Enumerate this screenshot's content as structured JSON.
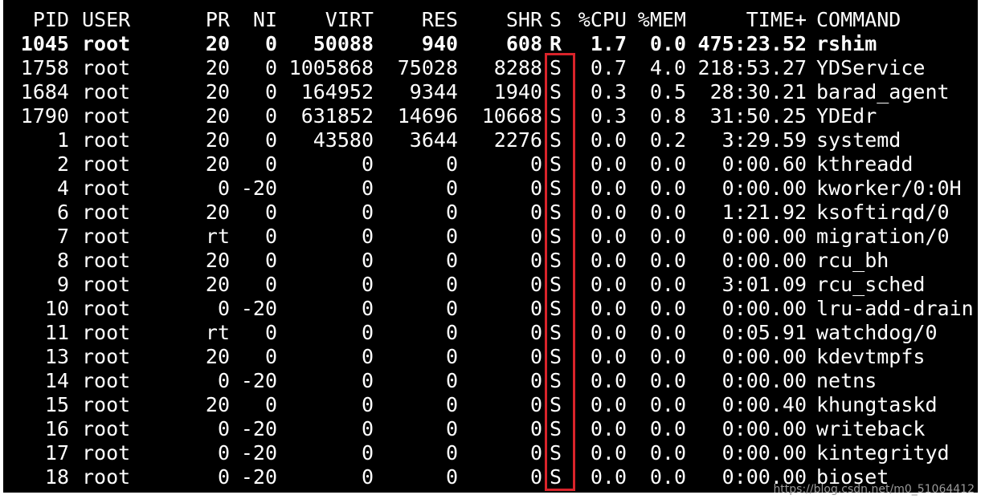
{
  "header": {
    "pid": "PID",
    "user": "USER",
    "pr": "PR",
    "ni": "NI",
    "virt": "VIRT",
    "res": "RES",
    "shr": "SHR",
    "s": "S",
    "cpu": "%CPU",
    "mem": "%MEM",
    "time": "TIME+",
    "command": "COMMAND"
  },
  "rows": [
    {
      "pid": "1045",
      "user": "root",
      "pr": "20",
      "ni": "0",
      "virt": "50088",
      "res": "940",
      "shr": "608",
      "s": "R",
      "cpu": "1.7",
      "mem": "0.0",
      "time": "475:23.52",
      "command": "rshim",
      "bold": true
    },
    {
      "pid": "1758",
      "user": "root",
      "pr": "20",
      "ni": "0",
      "virt": "1005868",
      "res": "75028",
      "shr": "8288",
      "s": "S",
      "cpu": "0.7",
      "mem": "4.0",
      "time": "218:53.27",
      "command": "YDService"
    },
    {
      "pid": "1684",
      "user": "root",
      "pr": "20",
      "ni": "0",
      "virt": "164952",
      "res": "9344",
      "shr": "1940",
      "s": "S",
      "cpu": "0.3",
      "mem": "0.5",
      "time": "28:30.21",
      "command": "barad_agent"
    },
    {
      "pid": "1790",
      "user": "root",
      "pr": "20",
      "ni": "0",
      "virt": "631852",
      "res": "14696",
      "shr": "10668",
      "s": "S",
      "cpu": "0.3",
      "mem": "0.8",
      "time": "31:50.25",
      "command": "YDEdr"
    },
    {
      "pid": "1",
      "user": "root",
      "pr": "20",
      "ni": "0",
      "virt": "43580",
      "res": "3644",
      "shr": "2276",
      "s": "S",
      "cpu": "0.0",
      "mem": "0.2",
      "time": "3:29.59",
      "command": "systemd"
    },
    {
      "pid": "2",
      "user": "root",
      "pr": "20",
      "ni": "0",
      "virt": "0",
      "res": "0",
      "shr": "0",
      "s": "S",
      "cpu": "0.0",
      "mem": "0.0",
      "time": "0:00.60",
      "command": "kthreadd"
    },
    {
      "pid": "4",
      "user": "root",
      "pr": "0",
      "ni": "-20",
      "virt": "0",
      "res": "0",
      "shr": "0",
      "s": "S",
      "cpu": "0.0",
      "mem": "0.0",
      "time": "0:00.00",
      "command": "kworker/0:0H"
    },
    {
      "pid": "6",
      "user": "root",
      "pr": "20",
      "ni": "0",
      "virt": "0",
      "res": "0",
      "shr": "0",
      "s": "S",
      "cpu": "0.0",
      "mem": "0.0",
      "time": "1:21.92",
      "command": "ksoftirqd/0"
    },
    {
      "pid": "7",
      "user": "root",
      "pr": "rt",
      "ni": "0",
      "virt": "0",
      "res": "0",
      "shr": "0",
      "s": "S",
      "cpu": "0.0",
      "mem": "0.0",
      "time": "0:00.00",
      "command": "migration/0"
    },
    {
      "pid": "8",
      "user": "root",
      "pr": "20",
      "ni": "0",
      "virt": "0",
      "res": "0",
      "shr": "0",
      "s": "S",
      "cpu": "0.0",
      "mem": "0.0",
      "time": "0:00.00",
      "command": "rcu_bh"
    },
    {
      "pid": "9",
      "user": "root",
      "pr": "20",
      "ni": "0",
      "virt": "0",
      "res": "0",
      "shr": "0",
      "s": "S",
      "cpu": "0.0",
      "mem": "0.0",
      "time": "3:01.09",
      "command": "rcu_sched"
    },
    {
      "pid": "10",
      "user": "root",
      "pr": "0",
      "ni": "-20",
      "virt": "0",
      "res": "0",
      "shr": "0",
      "s": "S",
      "cpu": "0.0",
      "mem": "0.0",
      "time": "0:00.00",
      "command": "lru-add-drain"
    },
    {
      "pid": "11",
      "user": "root",
      "pr": "rt",
      "ni": "0",
      "virt": "0",
      "res": "0",
      "shr": "0",
      "s": "S",
      "cpu": "0.0",
      "mem": "0.0",
      "time": "0:05.91",
      "command": "watchdog/0"
    },
    {
      "pid": "13",
      "user": "root",
      "pr": "20",
      "ni": "0",
      "virt": "0",
      "res": "0",
      "shr": "0",
      "s": "S",
      "cpu": "0.0",
      "mem": "0.0",
      "time": "0:00.00",
      "command": "kdevtmpfs"
    },
    {
      "pid": "14",
      "user": "root",
      "pr": "0",
      "ni": "-20",
      "virt": "0",
      "res": "0",
      "shr": "0",
      "s": "S",
      "cpu": "0.0",
      "mem": "0.0",
      "time": "0:00.00",
      "command": "netns"
    },
    {
      "pid": "15",
      "user": "root",
      "pr": "20",
      "ni": "0",
      "virt": "0",
      "res": "0",
      "shr": "0",
      "s": "S",
      "cpu": "0.0",
      "mem": "0.0",
      "time": "0:00.40",
      "command": "khungtaskd"
    },
    {
      "pid": "16",
      "user": "root",
      "pr": "0",
      "ni": "-20",
      "virt": "0",
      "res": "0",
      "shr": "0",
      "s": "S",
      "cpu": "0.0",
      "mem": "0.0",
      "time": "0:00.00",
      "command": "writeback"
    },
    {
      "pid": "17",
      "user": "root",
      "pr": "0",
      "ni": "-20",
      "virt": "0",
      "res": "0",
      "shr": "0",
      "s": "S",
      "cpu": "0.0",
      "mem": "0.0",
      "time": "0:00.00",
      "command": "kintegrityd"
    },
    {
      "pid": "18",
      "user": "root",
      "pr": "0",
      "ni": "-20",
      "virt": "0",
      "res": "0",
      "shr": "0",
      "s": "S",
      "cpu": "0.0",
      "mem": "0.0",
      "time": "0:00.00",
      "command": "bioset"
    }
  ],
  "watermark": "https://blog.csdn.net/m0_51064412",
  "colors": {
    "background": "#000000",
    "text": "#ffffff",
    "highlight": "#d9232a"
  }
}
